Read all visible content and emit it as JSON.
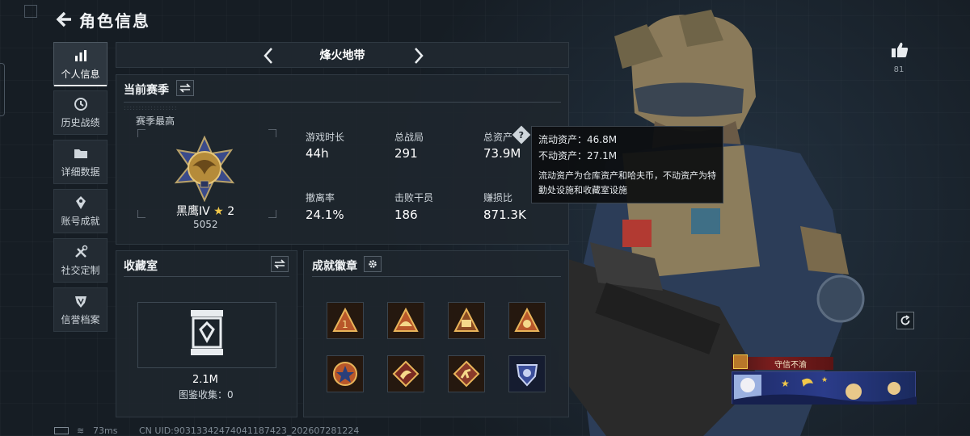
{
  "header": {
    "title": "角色信息"
  },
  "sidebar": {
    "items": [
      {
        "label": "个人信息",
        "icon": "bar-chart-icon",
        "active": true
      },
      {
        "label": "历史战绩",
        "icon": "history-clock-icon"
      },
      {
        "label": "详细数据",
        "icon": "folder-icon"
      },
      {
        "label": "账号成就",
        "icon": "achievement-icon"
      },
      {
        "label": "社交定制",
        "icon": "tools-icon"
      },
      {
        "label": "信誉档案",
        "icon": "reputation-shield-icon"
      }
    ]
  },
  "map_selector": {
    "current": "烽火地带"
  },
  "season": {
    "title": "当前赛季",
    "best_label": "赛季最高",
    "rank": {
      "name": "黑鹰IV",
      "stars": "2",
      "score": "5052"
    },
    "stats": [
      {
        "label": "游戏时长",
        "value": "44h"
      },
      {
        "label": "总战局",
        "value": "291"
      },
      {
        "label": "总资产",
        "value": "73.9M"
      },
      {
        "label": "撤离率",
        "value": "24.1%"
      },
      {
        "label": "击败干员",
        "value": "186"
      },
      {
        "label": "赚损比",
        "value": "871.3K"
      }
    ]
  },
  "tooltip": {
    "liquid_label": "流动资产：",
    "liquid_value": "46.8M",
    "fixed_label": "不动资产：",
    "fixed_value": "27.1M",
    "description": "流动资产为仓库资产和哈夫币，不动资产为特勤处设施和收藏室设施"
  },
  "collection": {
    "title": "收藏室",
    "value": "2.1M",
    "count_label": "图鉴收集：",
    "count_value": "0"
  },
  "badges": {
    "title": "成就徽章"
  },
  "likes": {
    "count": "81"
  },
  "player": {
    "title": "守信不渝"
  },
  "footer": {
    "ping": "73ms",
    "uid": "CN UID:90313342474041187423_202607281224"
  },
  "colors": {
    "background": "#161d24",
    "panel": "#1e262e",
    "accent_gold": "#f1c84a",
    "title_plate": "#7a1d1d"
  }
}
